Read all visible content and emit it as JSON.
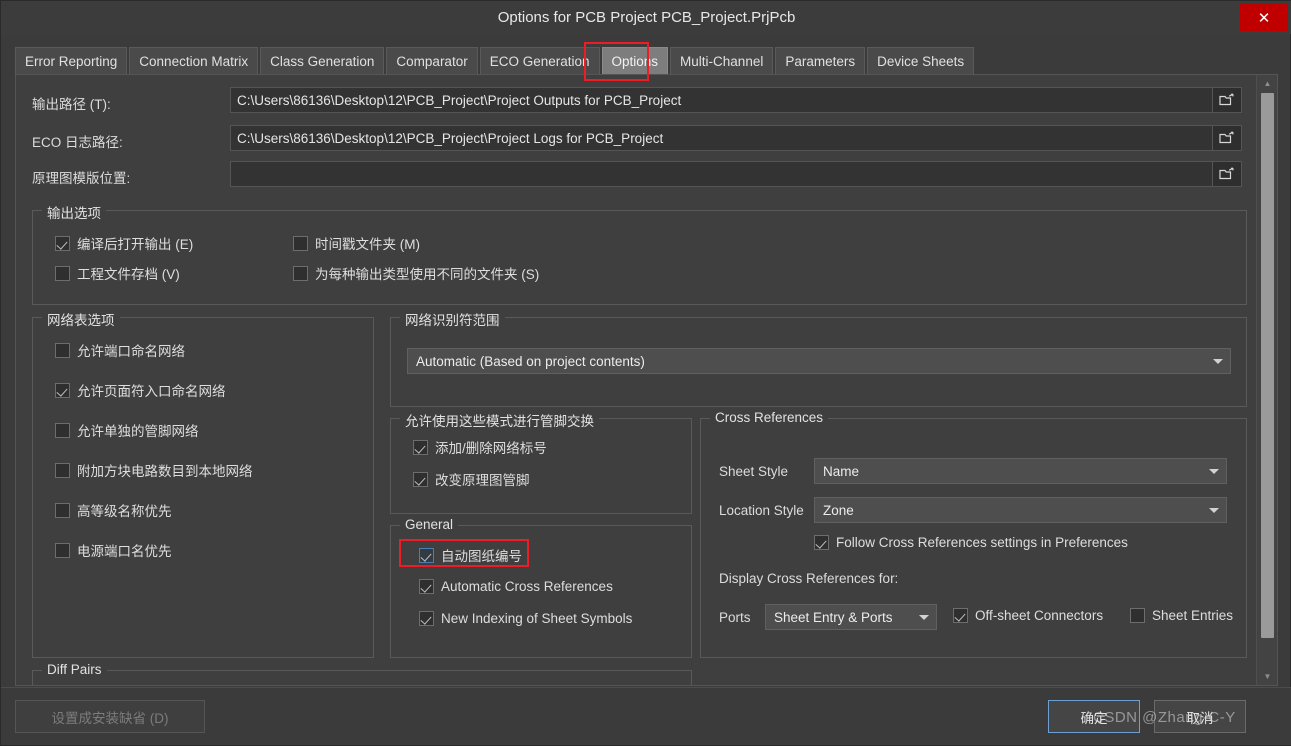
{
  "window": {
    "title": "Options for PCB Project PCB_Project.PrjPcb",
    "close_label": "✕",
    "accent_red": "#ee1c25",
    "close_bg": "#c00000"
  },
  "tabs": [
    {
      "label": "Error Reporting",
      "active": false
    },
    {
      "label": "Connection Matrix",
      "active": false
    },
    {
      "label": "Class Generation",
      "active": false
    },
    {
      "label": "Comparator",
      "active": false
    },
    {
      "label": "ECO Generation",
      "active": false
    },
    {
      "label": "Options",
      "active": true
    },
    {
      "label": "Multi-Channel",
      "active": false
    },
    {
      "label": "Parameters",
      "active": false
    },
    {
      "label": "Device Sheets",
      "active": false
    }
  ],
  "paths": {
    "output_label": "输出路径 (T):",
    "output_value": "C:\\Users\\86136\\Desktop\\12\\PCB_Project\\Project Outputs for PCB_Project",
    "eco_label": "ECO 日志路径:",
    "eco_value": "C:\\Users\\86136\\Desktop\\12\\PCB_Project\\Project Logs for PCB_Project",
    "template_label": "原理图模版位置:",
    "template_value": "",
    "browse_icon": "folder-open-icon"
  },
  "output_options": {
    "title": "输出选项",
    "items": [
      {
        "label": "编译后打开输出 (E)",
        "checked": true
      },
      {
        "label": "时间戳文件夹 (M)",
        "checked": false
      },
      {
        "label": "工程文件存档 (V)",
        "checked": false
      },
      {
        "label": "为每种输出类型使用不同的文件夹 (S)",
        "checked": false
      }
    ]
  },
  "netlist_options": {
    "title": "网络表选项",
    "items": [
      {
        "label": "允许端口命名网络",
        "checked": false
      },
      {
        "label": "允许页面符入口命名网络",
        "checked": true
      },
      {
        "label": "允许单独的管脚网络",
        "checked": false
      },
      {
        "label": "附加方块电路数目到本地网络",
        "checked": false
      },
      {
        "label": "高等级名称优先",
        "checked": false
      },
      {
        "label": "电源端口名优先",
        "checked": false
      }
    ]
  },
  "net_identifier_scope": {
    "title": "网络识别符范围",
    "value": "Automatic (Based on project contents)"
  },
  "pin_swap": {
    "title": "允许使用这些模式进行管脚交换",
    "items": [
      {
        "label": "添加/删除网络标号",
        "checked": true
      },
      {
        "label": "改变原理图管脚",
        "checked": true
      }
    ]
  },
  "general": {
    "title": "General",
    "items": [
      {
        "label": "自动图纸编号",
        "checked": true,
        "highlighted": true
      },
      {
        "label": "Automatic Cross References",
        "checked": true,
        "highlighted": false
      },
      {
        "label": "New Indexing of Sheet Symbols",
        "checked": true,
        "highlighted": false
      }
    ]
  },
  "cross_references": {
    "title": "Cross References",
    "sheet_style_label": "Sheet Style",
    "sheet_style_value": "Name",
    "location_style_label": "Location Style",
    "location_style_value": "Zone",
    "follow_label": "Follow Cross References settings in Preferences",
    "follow_checked": true,
    "display_for_label": "Display Cross References for:",
    "ports_label": "Ports",
    "ports_value": "Sheet Entry & Ports",
    "offsheet_label": "Off-sheet Connectors",
    "offsheet_checked": true,
    "sheet_entries_label": "Sheet Entries",
    "sheet_entries_checked": false
  },
  "diff_pairs": {
    "title": "Diff Pairs"
  },
  "footer": {
    "set_default_label": "设置成安装缺省 (D)",
    "ok_label": "确定",
    "cancel_label": "取消"
  },
  "watermark": "CSDN @Zhang-C-Y"
}
